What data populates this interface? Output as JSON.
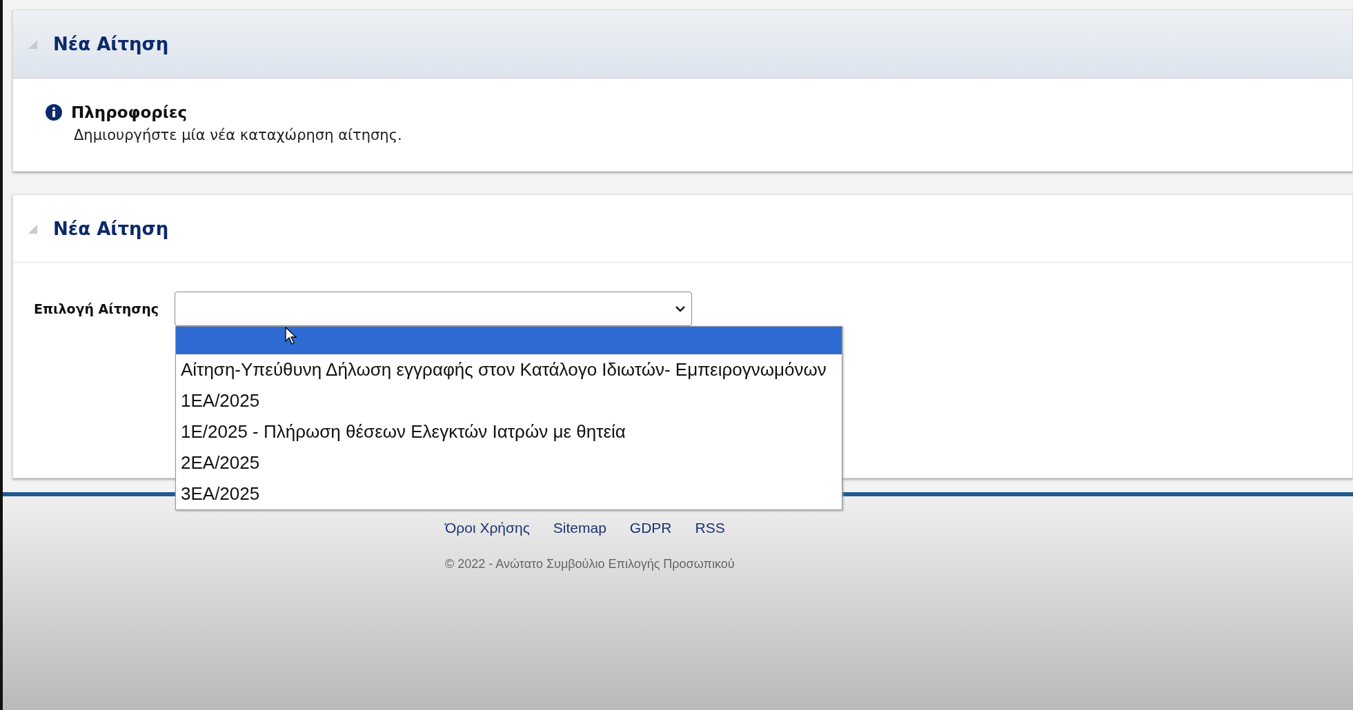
{
  "info_panel": {
    "title": "Νέα Αίτηση",
    "expanded": true,
    "info_title": "Πληροφορίες",
    "info_text": "Δημιουργήστε μία νέα καταχώρηση αίτησης."
  },
  "form_panel": {
    "title": "Νέα Αίτηση",
    "expanded": true,
    "field_label": "Επιλογή Αίτησης",
    "dropdown_open": true,
    "options": [
      {
        "selected": true
      },
      {
        "label": "Αίτηση-Υπεύθυνη Δήλωση εγγραφής στον Κατάλογο Ιδιωτών- Εμπειρογνωμόνων",
        "selected": false
      },
      {
        "label": "1ΕΑ/2025",
        "selected": false
      },
      {
        "label": "1Ε/2025 - Πλήρωση θέσεων Ελεγκτών Ιατρών με θητεία",
        "selected": false
      },
      {
        "label": "2ΕΑ/2025",
        "selected": false
      },
      {
        "label": "3ΕΑ/2025",
        "selected": false
      }
    ]
  },
  "footer": {
    "links": [
      "Όροι Χρήσης",
      "Sitemap",
      "GDPR",
      "RSS"
    ],
    "copyright": "© 2022 - Ανώτατο Συμβούλιο Επιλογής Προσωπικού"
  }
}
